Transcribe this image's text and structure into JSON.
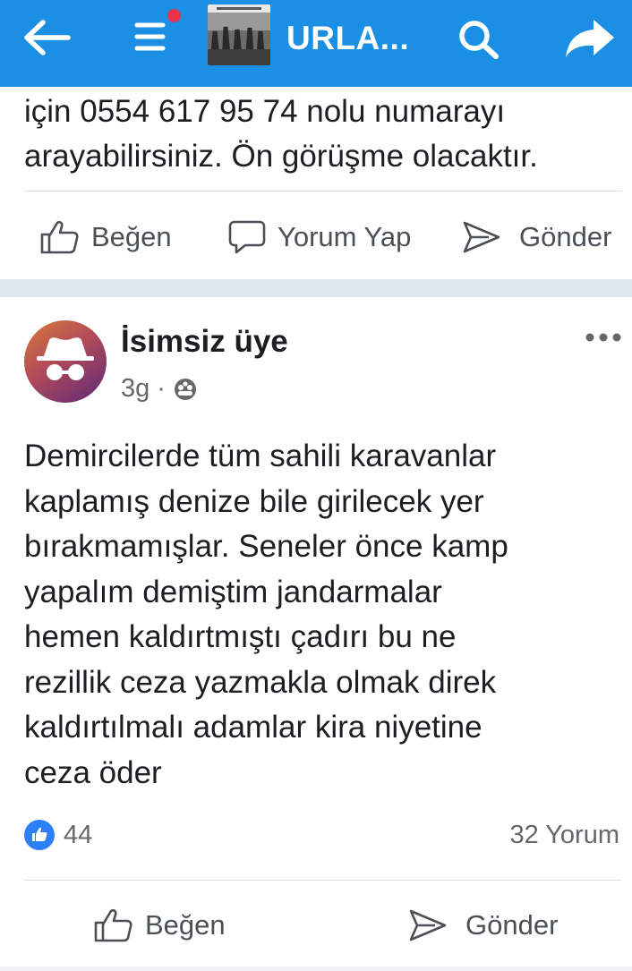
{
  "topbar": {
    "title": "URLA...",
    "bg_color": "#1a8fe3",
    "notification_dot_color": "#e8334a",
    "icons": [
      "back-arrow-icon",
      "menu-icon",
      "group-thumbnail",
      "search-icon",
      "share-icon"
    ]
  },
  "previous_post": {
    "text_line1": "için 0554 617 95 74 nolu numarayı",
    "text_line2": "arayabilirsiniz. Ön görüşme olacaktır.",
    "actions": {
      "like": "Beğen",
      "comment": "Yorum Yap",
      "send": "Gönder"
    }
  },
  "post": {
    "author": "İsimsiz üye",
    "time": "3g",
    "separator": "·",
    "privacy_icon": "group-audience-icon",
    "text_lines": [
      "Demircilerde tüm sahili karavanlar",
      "kaplamış denize bile girilecek yer",
      "bırakmamışlar. Seneler önce kamp",
      "yapalım demiştim jandarmalar",
      "hemen kaldırtmıştı çadırı bu ne",
      "rezillik ceza yazmakla olmak direk",
      "kaldırtılmalı adamlar kira niyetine",
      "ceza öder"
    ],
    "like_count": "44",
    "comment_count": "32 Yorum",
    "actions": {
      "like": "Beğen",
      "send": "Gönder"
    },
    "like_color": "#2d7ff9"
  }
}
